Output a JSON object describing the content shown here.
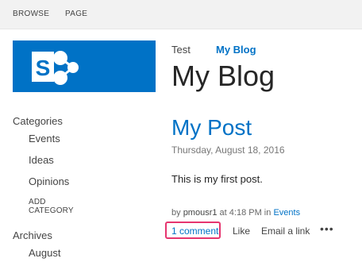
{
  "ribbon": {
    "tabs": [
      {
        "label": "BROWSE"
      },
      {
        "label": "PAGE"
      }
    ]
  },
  "logo": {
    "letter": "S",
    "color": "#0072c6"
  },
  "top_nav": {
    "links": [
      {
        "label": "Test"
      },
      {
        "label": "My Blog"
      }
    ]
  },
  "site_title": "My Blog",
  "left_nav": {
    "categories_heading": "Categories",
    "categories": [
      "Events",
      "Ideas",
      "Opinions"
    ],
    "add_category": "ADD CATEGORY",
    "archives_heading": "Archives",
    "archives": [
      "August"
    ]
  },
  "post": {
    "title": "My Post",
    "date": "Thursday, August 18, 2016",
    "body": "This is my first post.",
    "meta": {
      "prefix": "by",
      "author": "pmousr1",
      "at": "at 4:18 PM in",
      "category": "Events"
    },
    "actions": {
      "comment": "1 comment",
      "like": "Like",
      "email": "Email a link",
      "more": "•••"
    }
  },
  "colors": {
    "accent": "#0072c6",
    "highlight": "#e6356f"
  }
}
